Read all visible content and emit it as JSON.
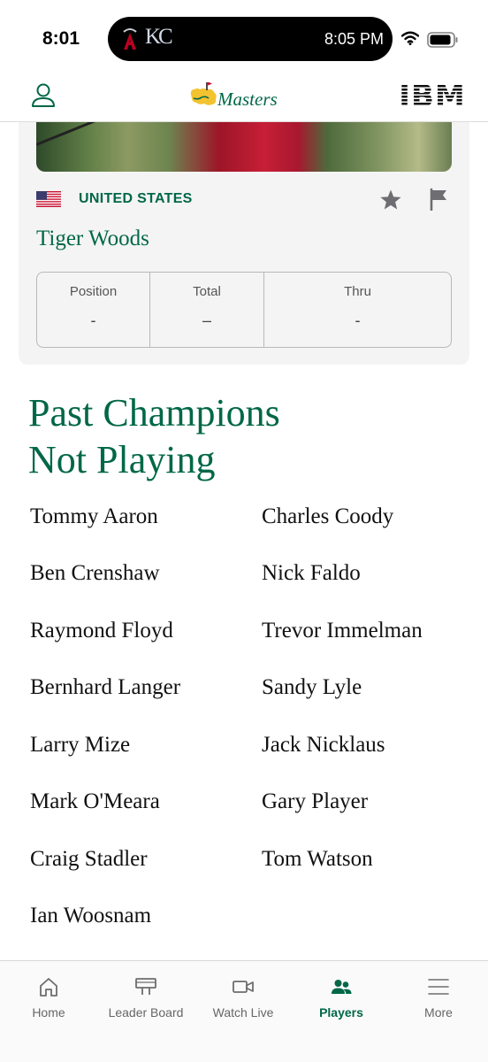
{
  "status_bar": {
    "time": "8:01",
    "live_activity_time": "8:05 PM",
    "live_activity_team_logo_text": "KC"
  },
  "header": {
    "brand": "Masters",
    "sponsor": "IBM"
  },
  "player_card": {
    "country": "UNITED STATES",
    "name": "Tiger Woods",
    "stats": [
      {
        "label": "Position",
        "value": "-"
      },
      {
        "label": "Total",
        "value": "–"
      },
      {
        "label": "Thru",
        "value": "-"
      }
    ]
  },
  "past_champions": {
    "title_line1": "Past Champions",
    "title_line2": "Not Playing",
    "names": [
      "Tommy Aaron",
      "Charles Coody",
      "Ben Crenshaw",
      "Nick Faldo",
      "Raymond Floyd",
      "Trevor Immelman",
      "Bernhard Langer",
      "Sandy Lyle",
      "Larry Mize",
      "Jack Nicklaus",
      "Mark O'Meara",
      "Gary Player",
      "Craig Stadler",
      "Tom Watson",
      "Ian Woosnam"
    ]
  },
  "tab_bar": {
    "tabs": [
      {
        "label": "Home",
        "icon": "home-icon"
      },
      {
        "label": "Leader Board",
        "icon": "leaderboard-icon"
      },
      {
        "label": "Watch Live",
        "icon": "video-camera-icon"
      },
      {
        "label": "Players",
        "icon": "players-icon"
      },
      {
        "label": "More",
        "icon": "menu-icon"
      }
    ],
    "active": "Players"
  },
  "colors": {
    "brand_green": "#006747",
    "masters_yellow": "#f2c230"
  }
}
